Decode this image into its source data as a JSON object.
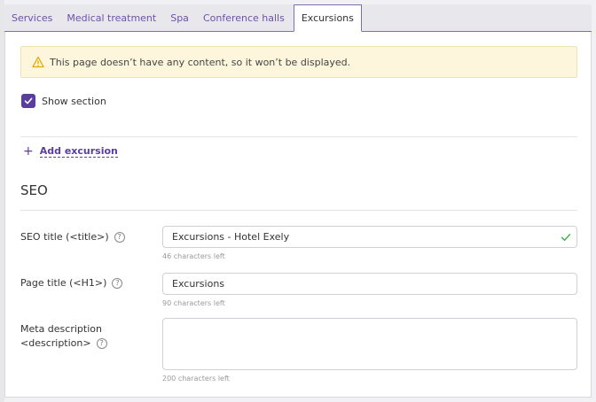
{
  "tabs": [
    {
      "label": "Services",
      "active": false
    },
    {
      "label": "Medical treatment",
      "active": false
    },
    {
      "label": "Spa",
      "active": false
    },
    {
      "label": "Conference halls",
      "active": false
    },
    {
      "label": "Excursions",
      "active": true
    }
  ],
  "notice": {
    "text": "This page doesn’t have any content, so it won’t be displayed.",
    "icon": "warning-icon"
  },
  "show_section": {
    "label": "Show section",
    "checked": true
  },
  "add_excursion": {
    "plus": "+",
    "label": "Add excursion"
  },
  "seo": {
    "heading": "SEO",
    "seo_title": {
      "label": "SEO title (<title>)",
      "value": "Excursions - Hotel Exely",
      "hint": "46 characters left",
      "valid": true
    },
    "page_title": {
      "label": "Page title (<H1>)",
      "value": "Excursions",
      "hint": "90 characters left"
    },
    "meta_description": {
      "label_line1": "Meta description",
      "label_line2": "<description>",
      "value": "",
      "hint": "200 characters left"
    },
    "help_glyph": "?"
  },
  "colors": {
    "accent": "#5a3e9b",
    "notice_bg": "#fdf6dc",
    "valid_check": "#4caf50"
  }
}
